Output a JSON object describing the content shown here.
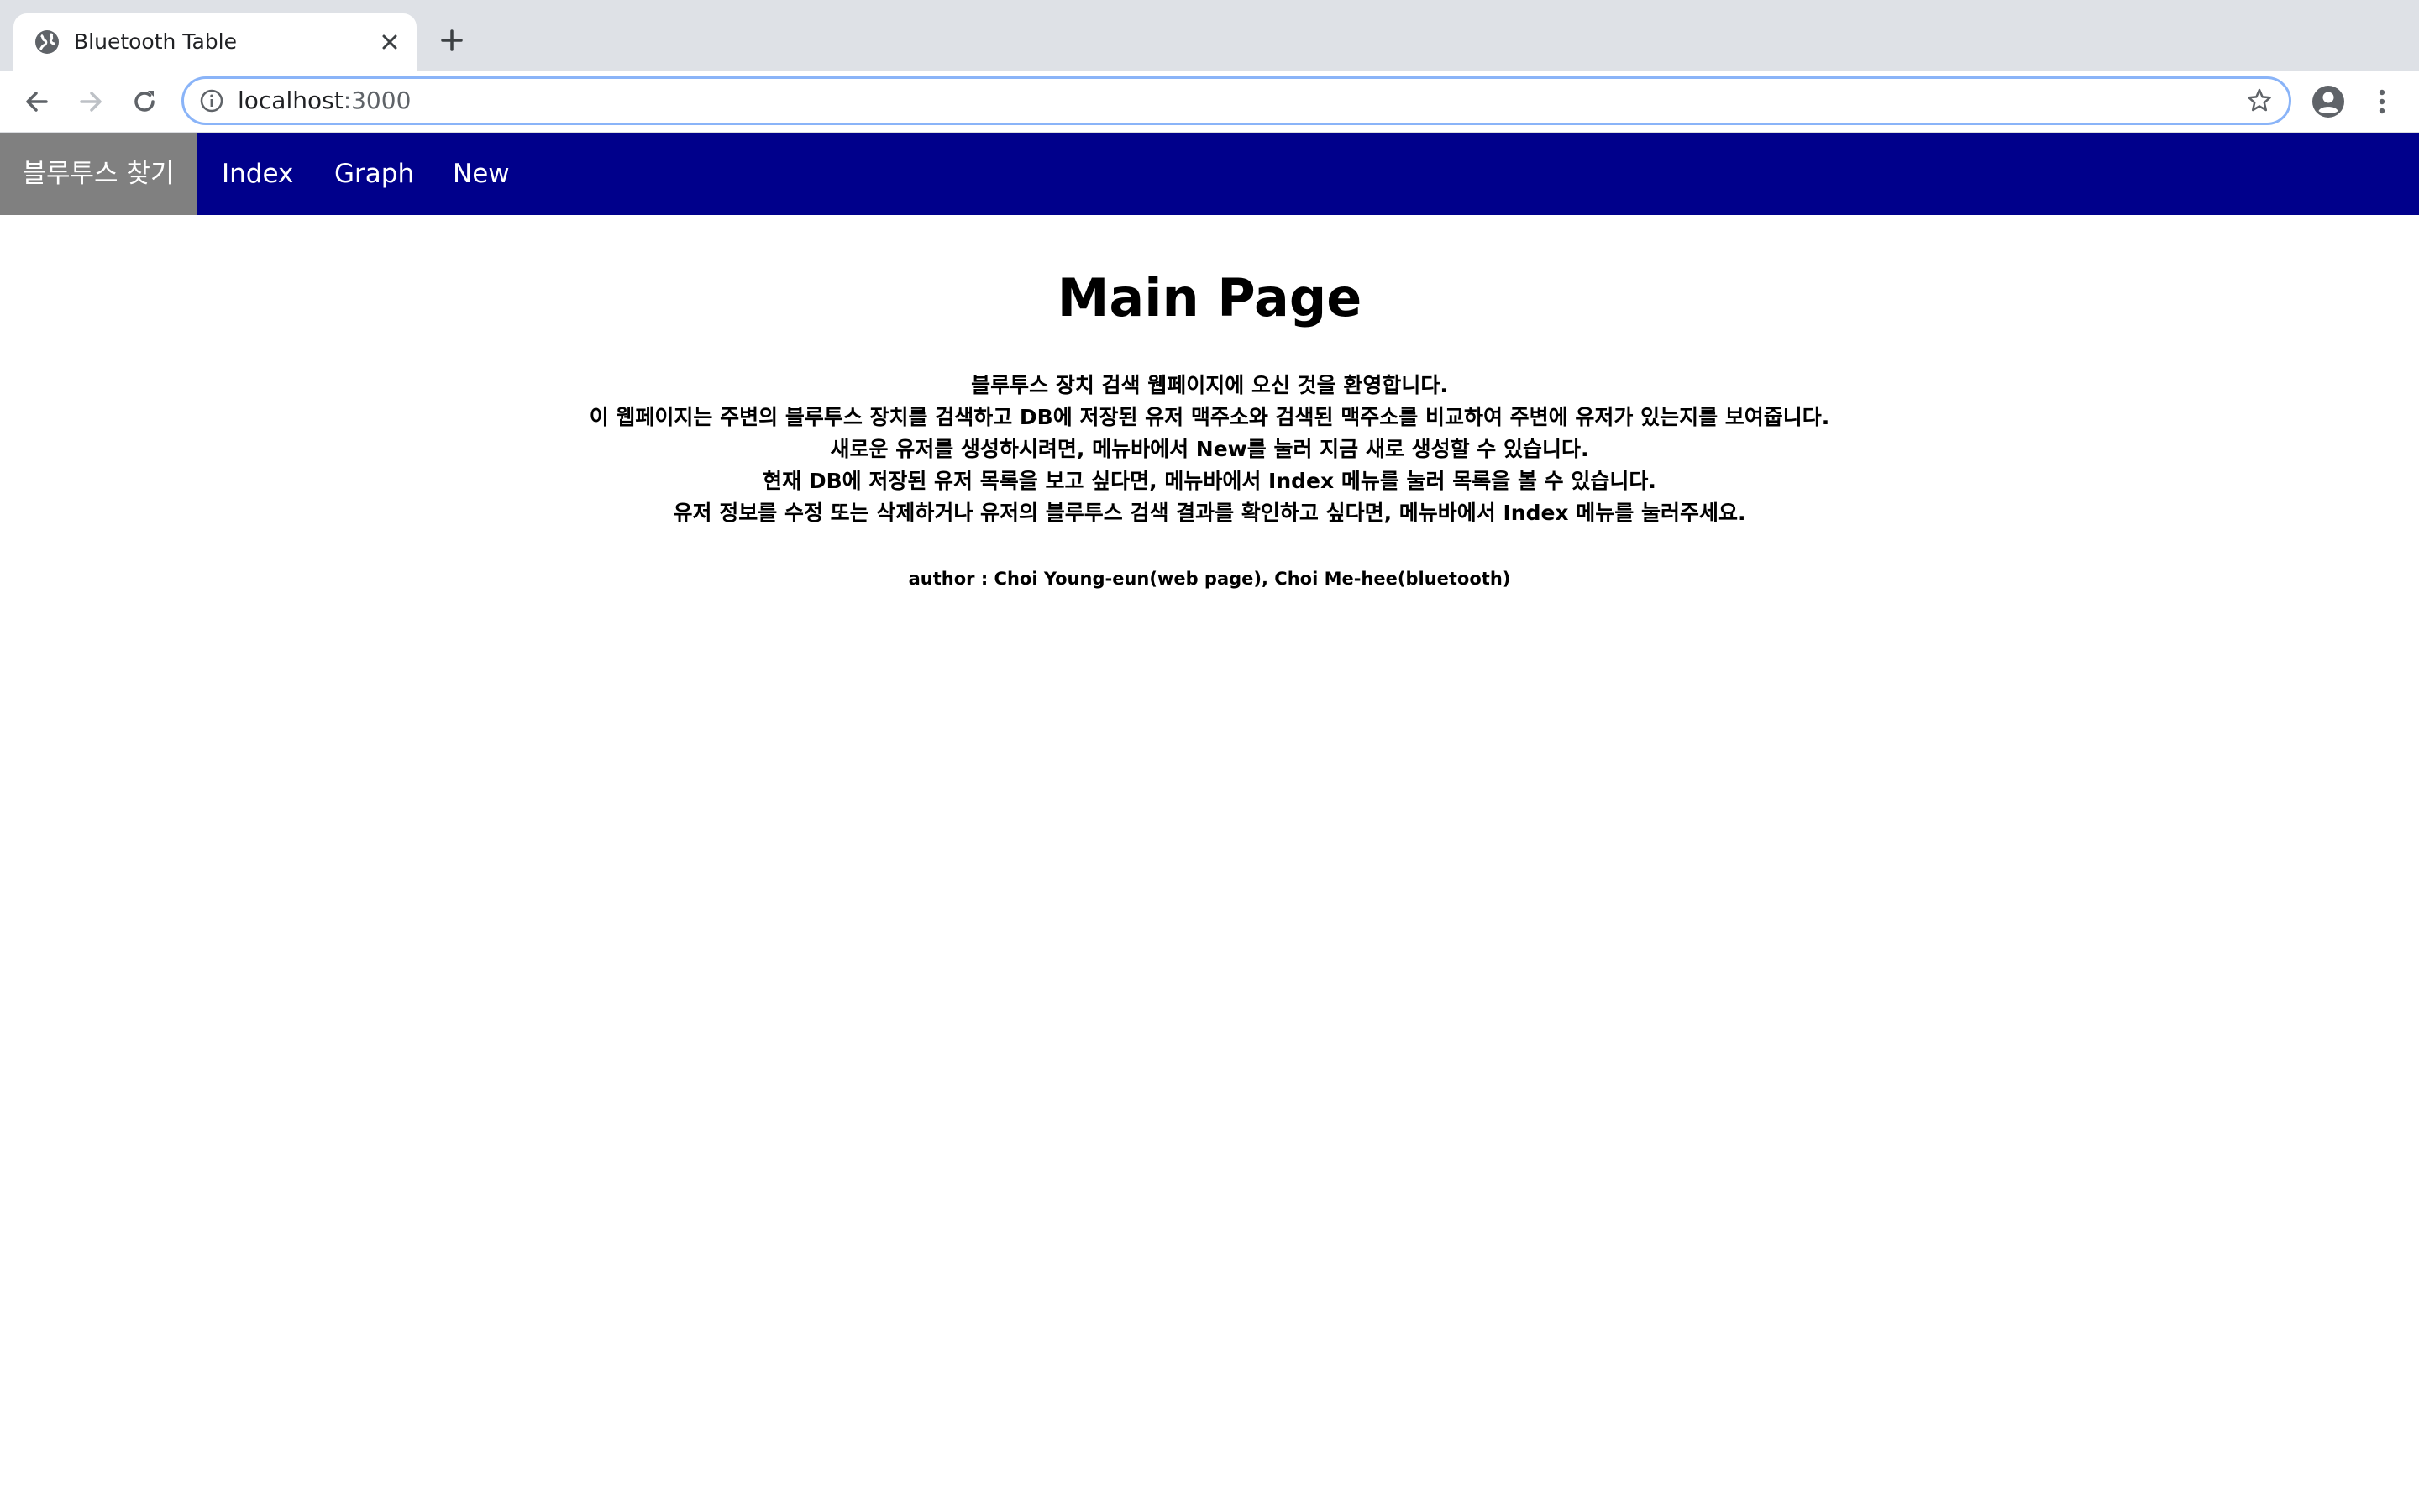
{
  "browser": {
    "tab": {
      "title": "Bluetooth Table",
      "favicon_icon": "globe-icon",
      "close_icon": "close-icon"
    },
    "new_tab_icon": "plus-icon",
    "toolbar": {
      "back_icon": "arrow-left-icon",
      "forward_icon": "arrow-right-icon",
      "reload_icon": "reload-icon",
      "info_icon": "info-icon",
      "bookmark_icon": "star-icon",
      "profile_icon": "account-circle-icon",
      "menu_icon": "kebab-menu-icon"
    },
    "address": {
      "host": "localhost",
      "port": ":3000"
    }
  },
  "navbar": {
    "brand": "블루투스 찾기",
    "links": [
      "Index",
      "Graph",
      "New"
    ],
    "colors": {
      "background": "#00008b",
      "brand_background": "#808080",
      "text": "#ffffff"
    }
  },
  "main": {
    "title": "Main Page",
    "intro_lines": [
      "블루투스 장치 검색 웹페이지에 오신 것을 환영합니다.",
      "이 웹페이지는 주변의 블루투스 장치를 검색하고 DB에 저장된 유저 맥주소와 검색된 맥주소를 비교하여 주변에 유저가 있는지를 보여줍니다.",
      "새로운 유저를 생성하시려면, 메뉴바에서 New를 눌러 지금 새로 생성할 수 있습니다.",
      "현재 DB에 저장된 유저 목록을 보고 싶다면, 메뉴바에서 Index 메뉴를 눌러 목록을 볼 수 있습니다.",
      "유저 정보를 수정 또는 삭제하거나 유저의 블루투스 검색 결과를 확인하고 싶다면, 메뉴바에서 Index 메뉴를 눌러주세요."
    ],
    "author": "author : Choi Young-eun(web page), Choi Me-hee(bluetooth)"
  }
}
